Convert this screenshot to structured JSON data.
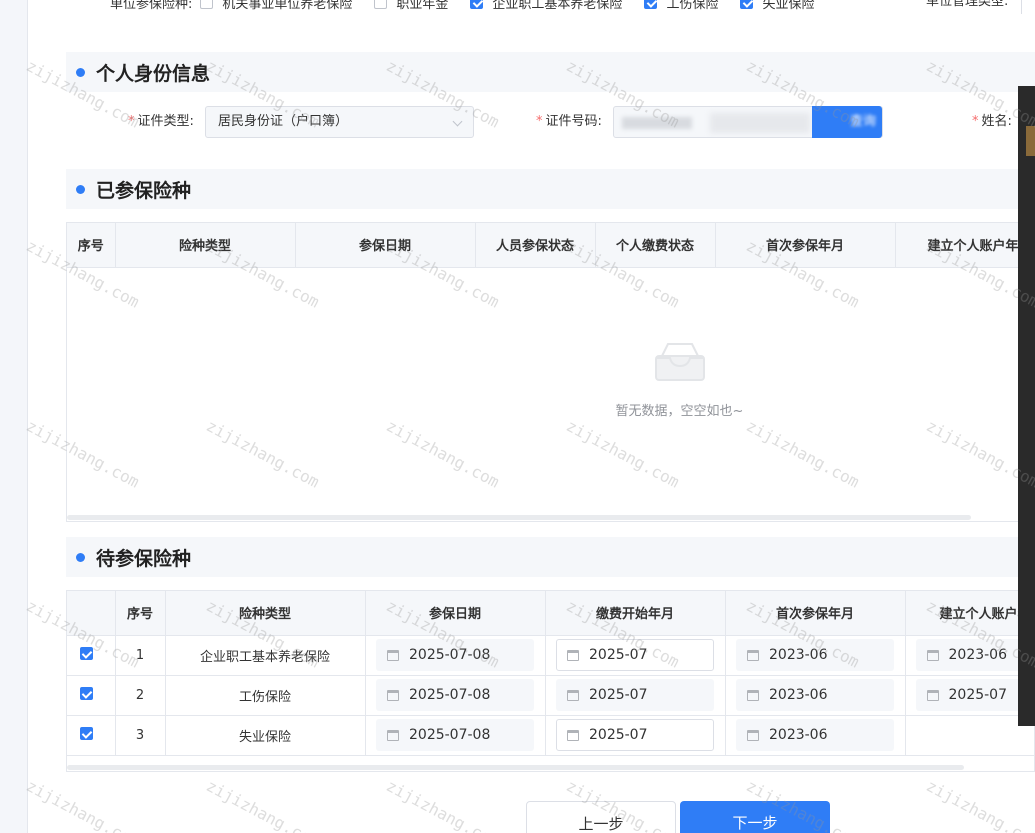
{
  "top_row": {
    "label": "单位参保险种:",
    "options": [
      {
        "label": "机关事业单位养老保险",
        "checked": false
      },
      {
        "label": "职业年金",
        "checked": false
      },
      {
        "label": "企业职工基本养老保险",
        "checked": true
      },
      {
        "label": "工伤保险",
        "checked": true
      },
      {
        "label": "失业保险",
        "checked": true
      }
    ],
    "right_label": "单位管理类型:"
  },
  "identity": {
    "title": "个人身份信息",
    "cert_type_label": "证件类型:",
    "cert_type_value": "居民身份证（户口簿）",
    "cert_no_label": "证件号码:",
    "query_label": "查询",
    "name_label": "姓名:"
  },
  "insured": {
    "title": "已参保险种",
    "columns": [
      "序号",
      "险种类型",
      "参保日期",
      "人员参保状态",
      "个人缴费状态",
      "首次参保年月",
      "建立个人账户年月"
    ],
    "empty_text": "暂无数据，空空如也~"
  },
  "pending": {
    "title": "待参保险种",
    "columns": [
      "",
      "序号",
      "险种类型",
      "参保日期",
      "缴费开始年月",
      "首次参保年月",
      "建立个人账户年月"
    ],
    "rows": [
      {
        "checked": true,
        "no": "1",
        "type": "企业职工基本养老保险",
        "insure_date": "2025-07-08",
        "pay_start": "2025-07",
        "first_month": "2023-06",
        "account_month": "2023-06"
      },
      {
        "checked": true,
        "no": "2",
        "type": "工伤保险",
        "insure_date": "2025-07-08",
        "pay_start": "2025-07",
        "first_month": "2023-06",
        "account_month": "2025-07"
      },
      {
        "checked": true,
        "no": "3",
        "type": "失业保险",
        "insure_date": "2025-07-08",
        "pay_start": "2025-07",
        "first_month": "2023-06",
        "account_month": ""
      }
    ]
  },
  "footer": {
    "prev_label": "上一步",
    "next_label": "下一步"
  },
  "watermark": "zijizhang.com",
  "colors": {
    "accent": "#2f7df6",
    "required": "#f56c6c",
    "header_bg": "#f5f7fa"
  }
}
